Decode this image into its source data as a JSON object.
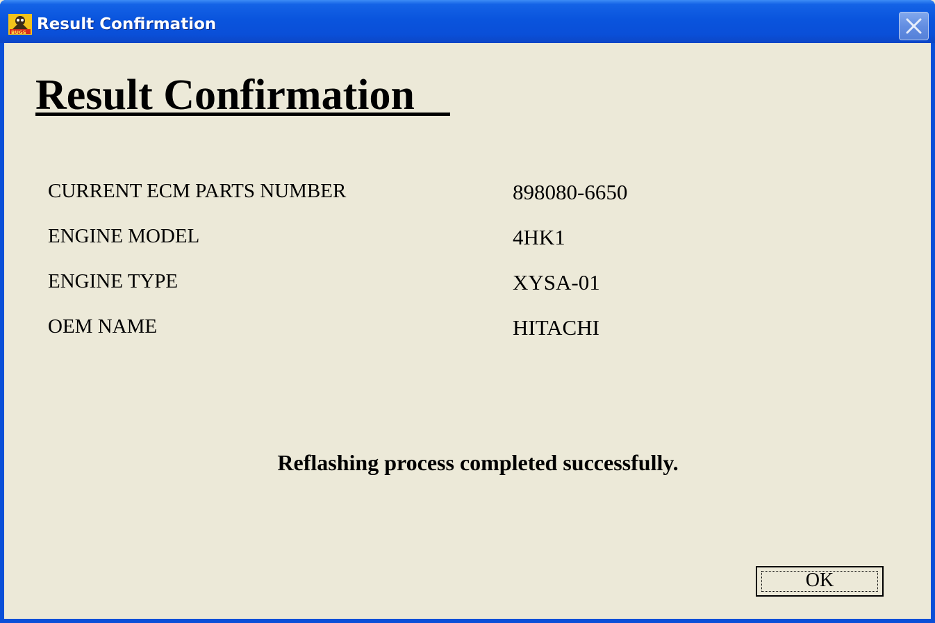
{
  "window": {
    "title": "Result Confirmation",
    "app_icon": "bugs-app-icon",
    "close_icon": "close-icon"
  },
  "content": {
    "heading": "Result Confirmation",
    "fields": [
      {
        "label": "CURRENT ECM PARTS NUMBER",
        "value": "898080-6650"
      },
      {
        "label": "ENGINE MODEL",
        "value": "4HK1"
      },
      {
        "label": "ENGINE TYPE",
        "value": "XYSA-01"
      },
      {
        "label": "OEM NAME",
        "value": "HITACHI"
      }
    ],
    "message": "Reflashing process completed successfully."
  },
  "buttons": {
    "ok_label": "OK"
  },
  "colors": {
    "titlebar": "#0a4fd8",
    "dialog_background": "#ece9d8",
    "text": "#000000"
  }
}
